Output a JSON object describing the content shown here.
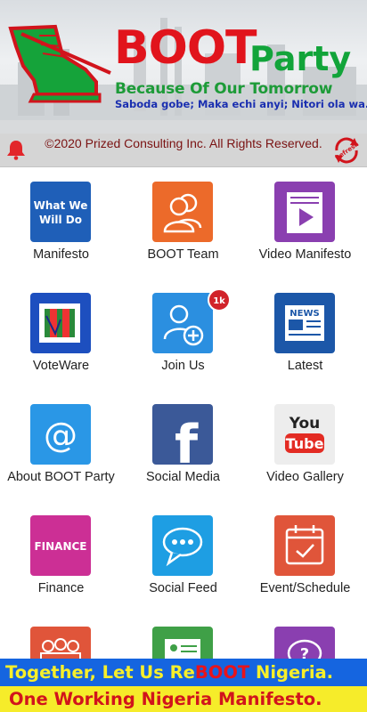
{
  "header": {
    "brand_boot": "BOOT",
    "brand_party": "Party",
    "tagline": "Because Of Our Tomorrow",
    "motto": "Saboda gobe; Maka echi anyi; Nitori ola wa..."
  },
  "notice": {
    "copyright": "©2020 Prized Consulting Inc. All Rights Reserved.",
    "refresh_label": "Refresh"
  },
  "grid": {
    "items": [
      {
        "label": "Manifesto",
        "icon": "what-we-will-do-icon",
        "tile_text": "What We Will Do",
        "color": "#1f5fb8"
      },
      {
        "label": "BOOT Team",
        "icon": "team-icon",
        "color": "#ec6a2a"
      },
      {
        "label": "Video Manifesto",
        "icon": "video-document-icon",
        "color": "#8a3fb0"
      },
      {
        "label": "VoteWare",
        "icon": "ballot-icon",
        "color": "#1d4fbf"
      },
      {
        "label": "Join Us",
        "icon": "add-user-icon",
        "color": "#2b8fe0",
        "badge": "1k"
      },
      {
        "label": "Latest",
        "icon": "news-icon",
        "tile_text": "NEWS",
        "color": "#1c57a8"
      },
      {
        "label": "About BOOT Party",
        "icon": "at-sign-icon",
        "color": "#2a97e6"
      },
      {
        "label": "Social Media",
        "icon": "facebook-icon",
        "color": "#3b5998"
      },
      {
        "label": "Video Gallery",
        "icon": "youtube-icon",
        "tile_text_top": "You",
        "tile_text_bottom": "Tube",
        "color": "#e32b23"
      },
      {
        "label": "Finance",
        "icon": "finance-icon",
        "tile_text": "FINANCE",
        "color": "#cc2f95"
      },
      {
        "label": "Social Feed",
        "icon": "chat-bubble-icon",
        "color": "#1e9ee3"
      },
      {
        "label": "Event/Schedule",
        "icon": "calendar-icon",
        "color": "#e0553a"
      },
      {
        "label": "",
        "icon": "group-icon",
        "color": "#e0553a"
      },
      {
        "label": "",
        "icon": "id-card-icon",
        "color": "#3fa047"
      },
      {
        "label": "",
        "icon": "help-icon",
        "color": "#8a3fb0"
      }
    ]
  },
  "footer": {
    "line1_pre": "Together, Let Us Re",
    "line1_em": "BOOT",
    "line1_post": " Nigeria.",
    "line2": "One Working Nigeria Manifesto."
  },
  "colors": {
    "brand_red": "#e1141c",
    "brand_green": "#12a43a",
    "footer_blue": "#1565e0",
    "footer_yellow": "#f6ec2a"
  }
}
